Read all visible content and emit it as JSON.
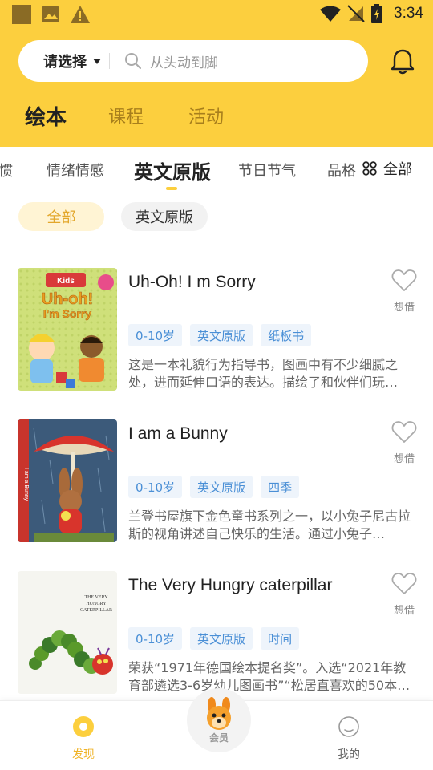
{
  "status_bar": {
    "time": "3:34",
    "icons": [
      "app-icon",
      "gallery-icon",
      "warning-icon",
      "wifi-icon",
      "signal-off-icon",
      "battery-icon"
    ]
  },
  "search": {
    "select_label": "请选择",
    "placeholder": "从头动到脚"
  },
  "main_tabs": [
    {
      "label": "绘本",
      "active": true
    },
    {
      "label": "课程",
      "active": false
    },
    {
      "label": "活动",
      "active": false
    }
  ],
  "categories": [
    {
      "label": "习惯",
      "active": false
    },
    {
      "label": "情绪情感",
      "active": false
    },
    {
      "label": "英文原版",
      "active": true
    },
    {
      "label": "节日节气",
      "active": false
    },
    {
      "label": "品格",
      "active": false
    }
  ],
  "all_label": "全部",
  "filter_chips": [
    {
      "label": "全部",
      "active": true
    },
    {
      "label": "英文原版",
      "active": false
    }
  ],
  "books": [
    {
      "title": "Uh-Oh! I m Sorry",
      "tags": [
        "0-10岁",
        "英文原版",
        "纸板书"
      ],
      "description": "这是一本礼貌行为指导书，图画中有不少细腻之处，进而延伸口语的表达。描绘了和伙伴们玩…",
      "fav_label": "想借",
      "cover_text": "Uh-oh! I'm Sorry"
    },
    {
      "title": "I am a Bunny",
      "tags": [
        "0-10岁",
        "英文原版",
        "四季"
      ],
      "description": "兰登书屋旗下金色童书系列之一，以小兔子尼古拉斯的视角讲述自己快乐的生活。通过小兔子…",
      "fav_label": "想借",
      "cover_text": "I am a Bunny"
    },
    {
      "title": "The Very Hungry caterpillar",
      "tags": [
        "0-10岁",
        "英文原版",
        "时间"
      ],
      "description": "荣获“1971年德国绘本提名奖”。入选“2021年教育部遴选3-6岁幼儿图画书”“松居直喜欢的50本…",
      "fav_label": "想借",
      "cover_text": "THE VERY HUNGRY CATERPILLAR"
    }
  ],
  "bottom_nav": {
    "discover": "发现",
    "member": "会员",
    "mine": "我的"
  },
  "colors": {
    "brand_yellow": "#fccf3e",
    "tag_blue": "#4a8fd6",
    "chip_active_text": "#e3a72b"
  }
}
